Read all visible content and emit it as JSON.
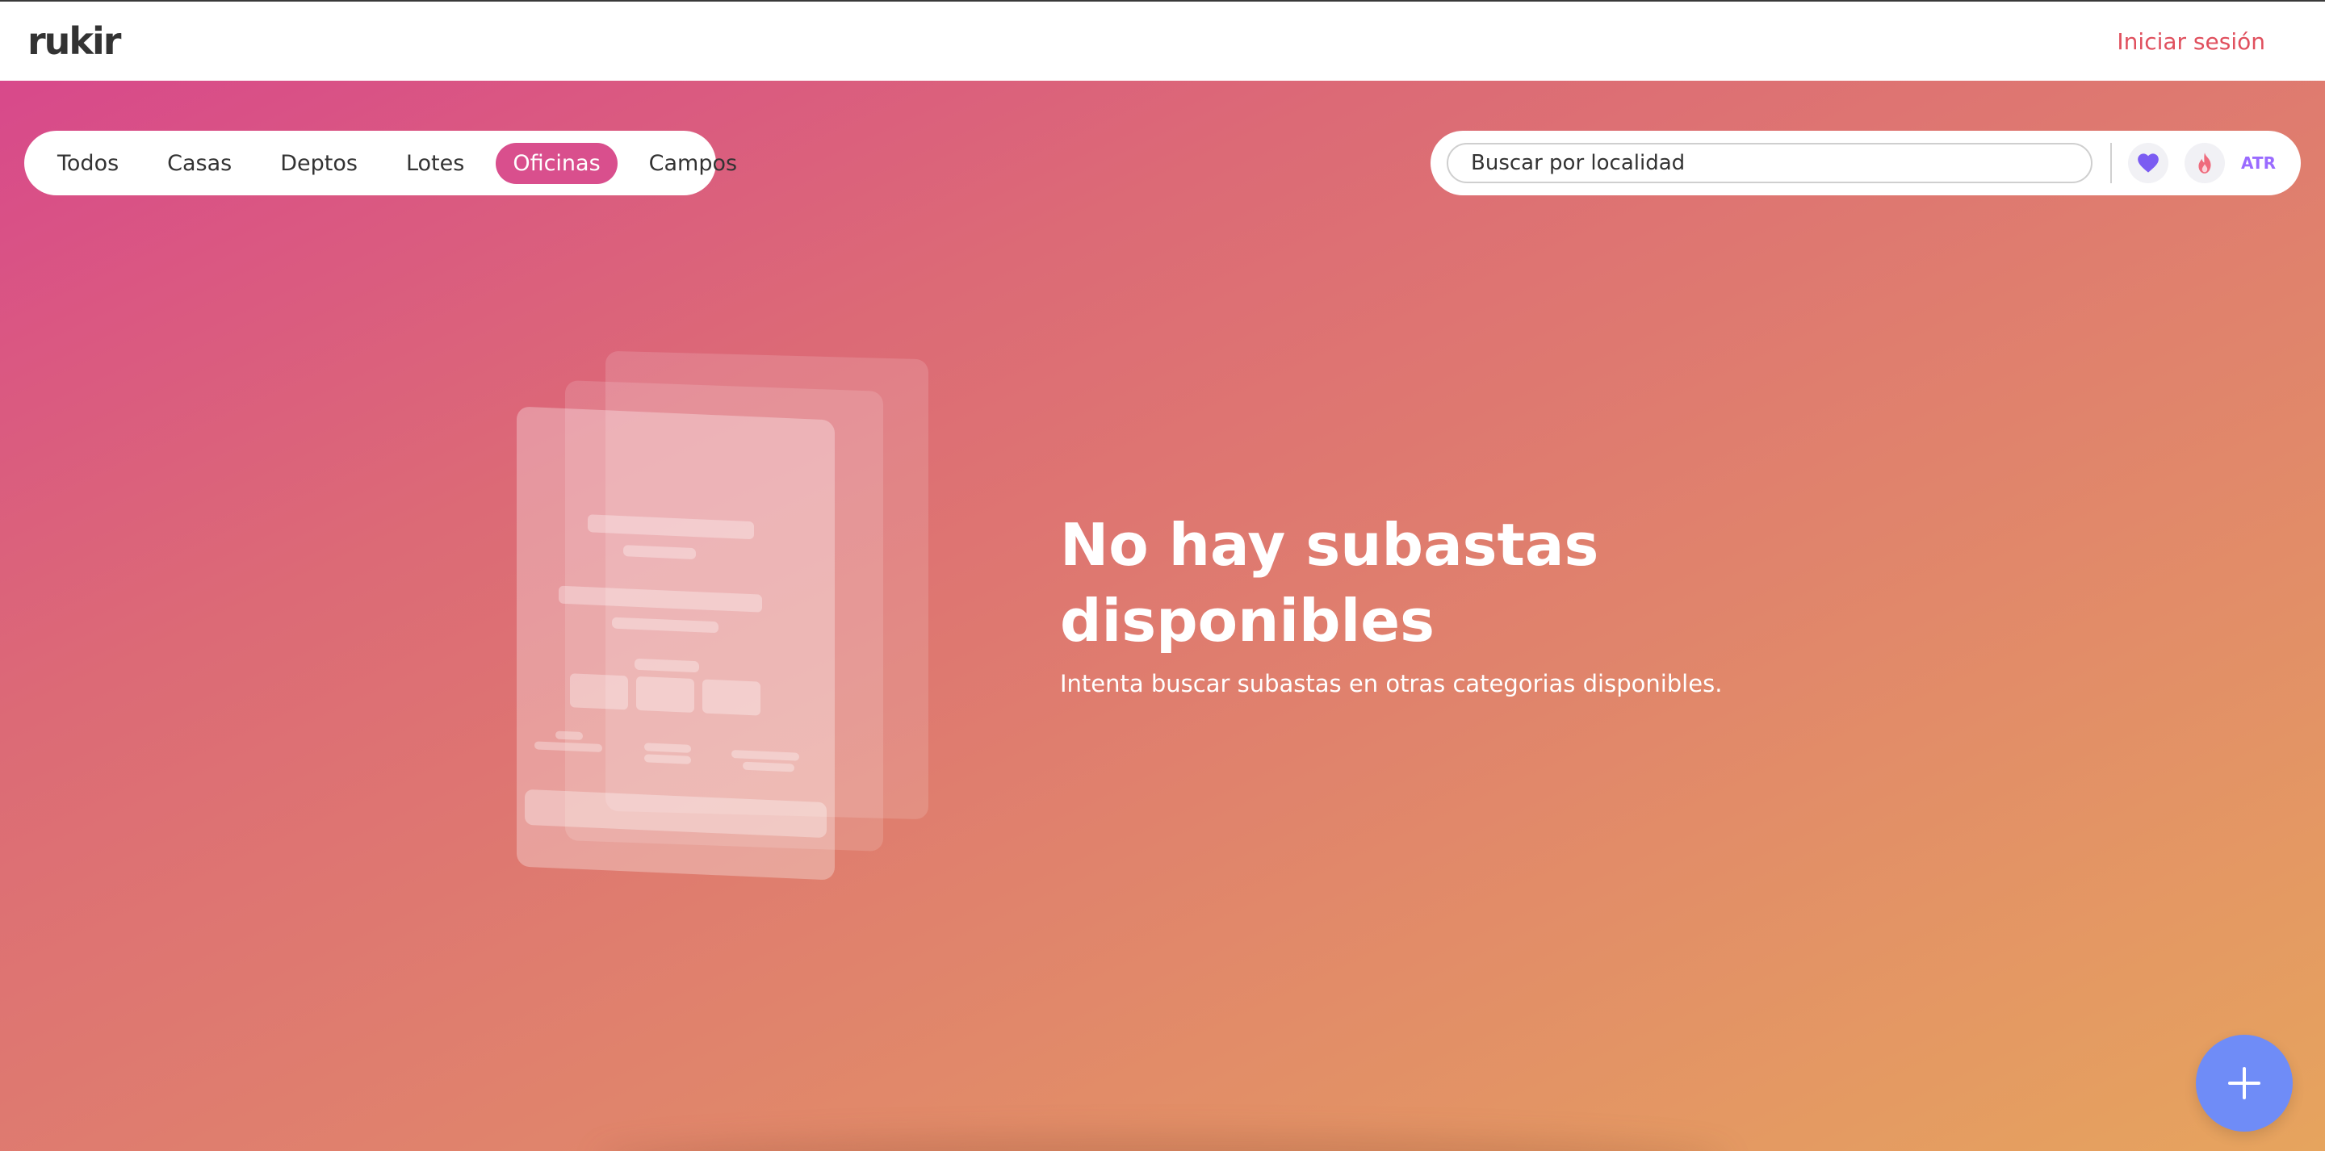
{
  "header": {
    "logo": "rukir",
    "login_label": "Iniciar sesión"
  },
  "categories": [
    {
      "label": "Todos",
      "active": false
    },
    {
      "label": "Casas",
      "active": false
    },
    {
      "label": "Deptos",
      "active": false
    },
    {
      "label": "Lotes",
      "active": false
    },
    {
      "label": "Oficinas",
      "active": true
    },
    {
      "label": "Campos",
      "active": false
    }
  ],
  "search": {
    "placeholder": "Buscar por localidad",
    "favorites_icon": "heart-icon",
    "trending_icon": "fire-icon",
    "atr_label": "ATR"
  },
  "empty_state": {
    "title": "No hay subastas disponibles",
    "subtitle": "Intenta buscar subastas en otras categorias disponibles."
  },
  "fab": {
    "icon": "plus-icon"
  },
  "colors": {
    "active_category": "#d94f8d",
    "login_text": "#e0505e",
    "fab": "#6f8cf7",
    "heart": "#7b5cf2",
    "fire": "#ef6b7d",
    "atr": "#9a6bff"
  }
}
